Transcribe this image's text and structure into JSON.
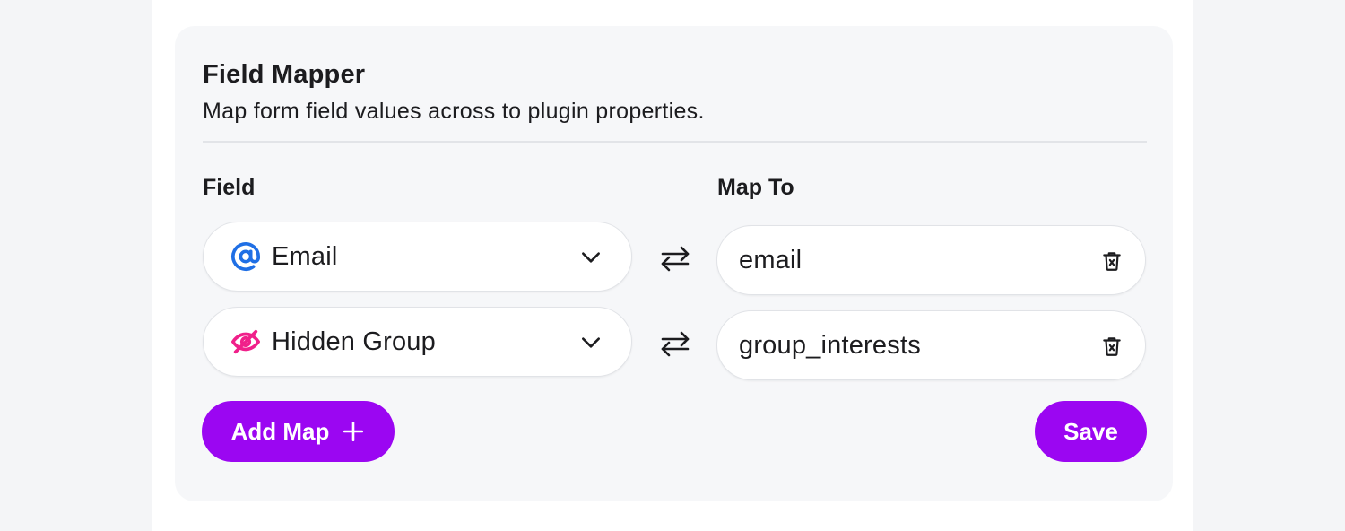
{
  "panel": {
    "title": "Field Mapper",
    "subtitle": "Map form field values across to plugin properties."
  },
  "columns": {
    "field": "Field",
    "map_to": "Map To"
  },
  "rows": [
    {
      "field_label": "Email",
      "field_icon": "at-sign-icon",
      "icon_color": "#1f6fe5",
      "map_value": "email"
    },
    {
      "field_label": "Hidden Group",
      "field_icon": "eye-off-icon",
      "icon_color": "#f0208a",
      "map_value": "group_interests"
    }
  ],
  "buttons": {
    "add_map": "Add Map",
    "save": "Save"
  },
  "colors": {
    "accent": "#9b06f2",
    "panel_bg": "#f6f7f9",
    "page_bg": "#f4f5f7"
  }
}
